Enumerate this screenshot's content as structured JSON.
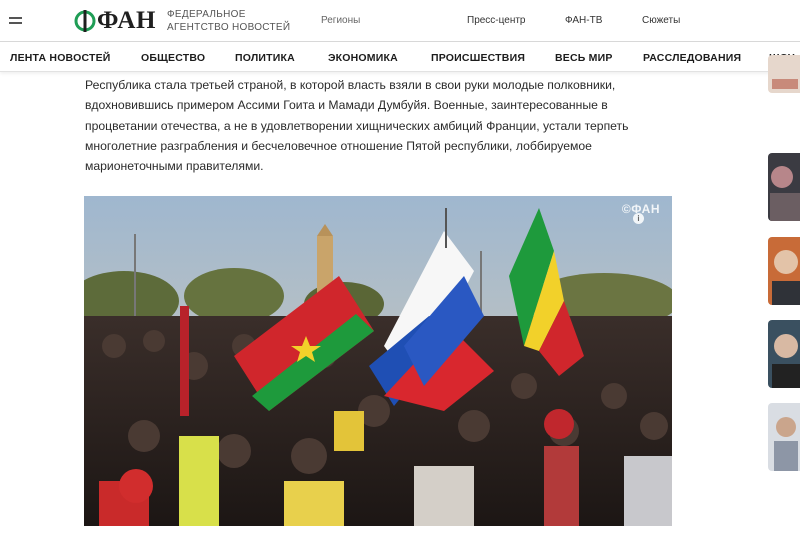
{
  "header": {
    "logo_text": "ФАН",
    "logo_subtitle_line1": "ФЕДЕРАЛЬНОЕ",
    "logo_subtitle_line2": "АГЕНТСТВО НОВОСТЕЙ",
    "links": [
      "Регионы",
      "Пресс-центр",
      "ФАН-ТВ",
      "Сюжеты"
    ],
    "menu_icon": "hamburger-icon"
  },
  "nav": {
    "items": [
      "ЛЕНТА НОВОСТЕЙ",
      "ОБЩЕСТВО",
      "ПОЛИТИКА",
      "ЭКОНОМИКА",
      "ПРОИСШЕСТВИЯ",
      "ВЕСЬ МИР",
      "РАССЛЕДОВАНИЯ",
      "ШОУ-"
    ]
  },
  "article": {
    "lines": [
      "Республика стала третьей страной, в которой власть взяли в свои руки молодые полковники,",
      "вдохновившись примером Ассими Гоита и Мамади Думбуйя. Военные, заинтересованные в",
      "процветании отечества, а не в удовлетворении хищнических амбиций Франции, устали терпеть",
      "многолетние разграбления и бесчеловечное отношение Пятой республики, лоббируемое",
      "марионеточными правителями."
    ],
    "photo_watermark": "©ФАН",
    "photo_info_icon": "i"
  },
  "colors": {
    "logo_green": "#1f9d55",
    "text": "#2b2b2b",
    "flag_burkina_red": "#d0262c",
    "flag_burkina_green": "#1e9a3c",
    "flag_russia_blue": "#1f4fb4",
    "flag_mali_yellow": "#f2d12a"
  }
}
